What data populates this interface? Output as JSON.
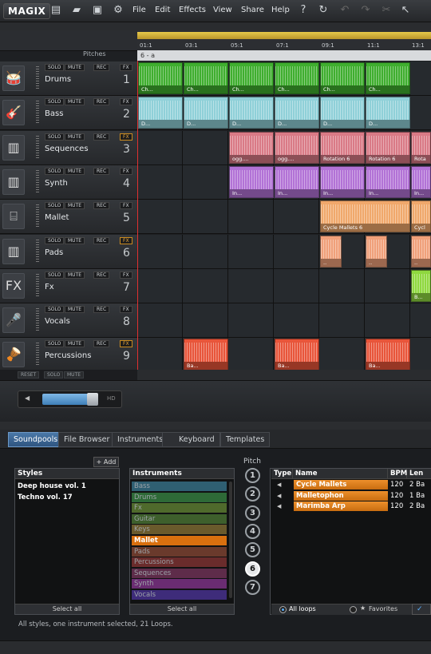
{
  "app": {
    "logo": "MAGIX"
  },
  "menu": [
    "File",
    "Edit",
    "Effects",
    "View",
    "Share",
    "Help"
  ],
  "toolbar_icons": [
    "new-file-icon",
    "open-folder-icon",
    "save-icon",
    "settings-gear-icon"
  ],
  "right_icons": [
    "help-icon",
    "loop-icon",
    "undo-icon",
    "redo-icon",
    "scissors-icon",
    "pointer-icon"
  ],
  "arranger": {
    "pitches_label": "Pitches",
    "ruler_ticks": [
      "01:1",
      "03:1",
      "05:1",
      "07:1",
      "09:1",
      "11:1",
      "13:1"
    ],
    "marker": "6 - a",
    "track_buttons": {
      "solo": "SOLO",
      "mute": "MUTE",
      "rec": "REC",
      "fx": "FX"
    },
    "tracks": [
      {
        "name": "Drums",
        "num": "1",
        "icon": "drum-kit-icon",
        "glyph": "🥁",
        "fx_on": false
      },
      {
        "name": "Bass",
        "num": "2",
        "icon": "bass-guitar-icon",
        "glyph": "🎸",
        "fx_on": false
      },
      {
        "name": "Sequences",
        "num": "3",
        "icon": "sequencer-icon",
        "glyph": "▥",
        "fx_on": true
      },
      {
        "name": "Synth",
        "num": "4",
        "icon": "synth-sliders-icon",
        "glyph": "▥",
        "fx_on": false
      },
      {
        "name": "Mallet",
        "num": "5",
        "icon": "xylophone-icon",
        "glyph": "⌸",
        "fx_on": false
      },
      {
        "name": "Pads",
        "num": "6",
        "icon": "pads-sliders-icon",
        "glyph": "▥",
        "fx_on": true
      },
      {
        "name": "Fx",
        "num": "7",
        "icon": "sound-fx-icon",
        "glyph": "FX",
        "fx_on": false
      },
      {
        "name": "Vocals",
        "num": "8",
        "icon": "microphone-icon",
        "glyph": "🎤",
        "fx_on": false
      },
      {
        "name": "Percussions",
        "num": "9",
        "icon": "bongo-drums-icon",
        "glyph": "🪘",
        "fx_on": true
      }
    ],
    "clip_labels": {
      "drums": "Ch...",
      "bass": "D...",
      "sequences_a": "Rotation 6",
      "sequences_b": "ogg....",
      "sequences_c": "Rota",
      "synth": "In...",
      "mallet_a": "Cycle Mallets 6",
      "mallet_b": "Cycl",
      "pads": "..",
      "fx": "B...",
      "perc": "Ba..."
    },
    "footer": {
      "reset": "RESET",
      "solo": "SOLO",
      "mute": "MUTE"
    },
    "zoom_hd": "HD"
  },
  "browser": {
    "tabs": [
      "Soundpools",
      "File Browser",
      "Instruments",
      "Keyboard",
      "Templates"
    ],
    "active_tab": 0,
    "styles": {
      "title": "Styles",
      "add_label": "+ Add",
      "items": [
        "Deep house vol. 1",
        "Techno vol. 17"
      ],
      "select_all": "Select all"
    },
    "instruments": {
      "title": "Instruments",
      "items": [
        {
          "label": "Bass",
          "color": "#2f5f72"
        },
        {
          "label": "Drums",
          "color": "#2e6a37"
        },
        {
          "label": "Fx",
          "color": "#4f6a2c"
        },
        {
          "label": "Guitar",
          "color": "#3e5f2c"
        },
        {
          "label": "Keys",
          "color": "#6a5a2c"
        },
        {
          "label": "Mallet",
          "color": "#d9700f"
        },
        {
          "label": "Pads",
          "color": "#6a3a2c"
        },
        {
          "label": "Percussions",
          "color": "#6a2c2c"
        },
        {
          "label": "Sequences",
          "color": "#5e2c4a"
        },
        {
          "label": "Synth",
          "color": "#6a2c72"
        },
        {
          "label": "Vocals",
          "color": "#3e2c7a"
        }
      ],
      "selected": 5,
      "select_all": "Select all"
    },
    "pitch": {
      "label": "Pitch",
      "values": [
        "1",
        "2",
        "3",
        "4",
        "5",
        "6",
        "7"
      ],
      "active": 5
    },
    "loops": {
      "headers": [
        "Type",
        "Name",
        "BPM",
        "Len"
      ],
      "rows": [
        {
          "name": "Cycle Mallets",
          "bpm": "120",
          "len": "2 Ba"
        },
        {
          "name": "Malletophon",
          "bpm": "120",
          "len": "1 Ba"
        },
        {
          "name": "Marimba Arp",
          "bpm": "120",
          "len": "2 Ba"
        }
      ],
      "all_loops": "All loops",
      "favorites": "Favorites"
    },
    "status": "All styles, one instrument selected, 21 Loops."
  }
}
